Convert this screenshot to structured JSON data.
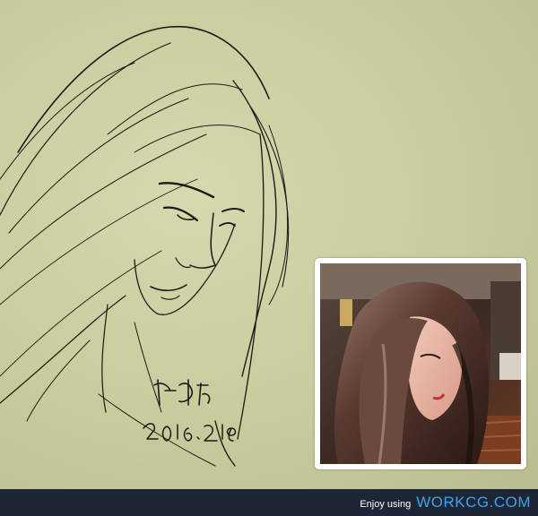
{
  "artwork": {
    "signature_mark": "柳叶刀",
    "signature_date": "2016.2.18"
  },
  "photo": {
    "description_icon": "reference-photo"
  },
  "footer": {
    "enjoy_label": "Enjoy using",
    "brand_label": "WORKCG.COM"
  },
  "colors": {
    "paper": "#c8cb9c",
    "ink": "#1a1a14",
    "footer_bg": "#1e2636",
    "brand": "#3fa2e8"
  }
}
